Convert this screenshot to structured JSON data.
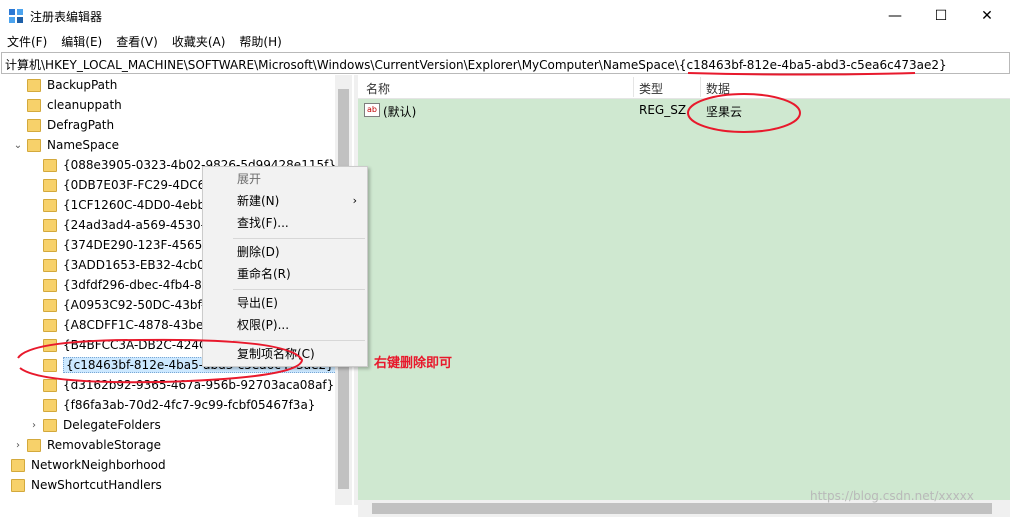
{
  "window": {
    "title": "注册表编辑器",
    "min_glyph": "—",
    "max_glyph": "☐",
    "close_glyph": "✕",
    "icon": "regedit-icon"
  },
  "menu": [
    "文件(F)",
    "编辑(E)",
    "查看(V)",
    "收藏夹(A)",
    "帮助(H)"
  ],
  "address": "计算机\\HKEY_LOCAL_MACHINE\\SOFTWARE\\Microsoft\\Windows\\CurrentVersion\\Explorer\\MyComputer\\NameSpace\\{c18463bf-812e-4ba5-abd3-c5ea6c473ae2}",
  "tree": [
    {
      "label": "BackupPath",
      "level": 1,
      "expander": ""
    },
    {
      "label": "cleanuppath",
      "level": 1,
      "expander": ""
    },
    {
      "label": "DefragPath",
      "level": 1,
      "expander": ""
    },
    {
      "label": "NameSpace",
      "level": 1,
      "expander": "⌄"
    },
    {
      "label": "{088e3905-0323-4b02-9826-5d99428e115f}",
      "level": 2,
      "expander": ""
    },
    {
      "label": "{0DB7E03F-FC29-4DC6-9",
      "level": 2,
      "expander": ""
    },
    {
      "label": "{1CF1260C-4DD0-4ebb-8",
      "level": 2,
      "expander": ""
    },
    {
      "label": "{24ad3ad4-a569-4530-9",
      "level": 2,
      "expander": ""
    },
    {
      "label": "{374DE290-123F-4565-9",
      "level": 2,
      "expander": ""
    },
    {
      "label": "{3ADD1653-EB32-4cb0-E",
      "level": 2,
      "expander": ""
    },
    {
      "label": "{3dfdf296-dbec-4fb4-81",
      "level": 2,
      "expander": ""
    },
    {
      "label": "{A0953C92-50DC-43bf-B",
      "level": 2,
      "expander": ""
    },
    {
      "label": "{A8CDFF1C-4878-43be-E",
      "level": 2,
      "expander": ""
    },
    {
      "label": "{B4BFCC3A-DB2C-424C-",
      "level": 2,
      "expander": ""
    },
    {
      "label": "{c18463bf-812e-4ba5-abd3-c5ea6c473ae2}",
      "level": 2,
      "expander": "",
      "selected": true
    },
    {
      "label": "{d3162b92-9365-467a-956b-92703aca08af}",
      "level": 2,
      "expander": ""
    },
    {
      "label": "{f86fa3ab-70d2-4fc7-9c99-fcbf05467f3a}",
      "level": 2,
      "expander": ""
    },
    {
      "label": "DelegateFolders",
      "level": 2,
      "expander": "›"
    },
    {
      "label": "RemovableStorage",
      "level": 1,
      "expander": "›"
    },
    {
      "label": "NetworkNeighborhood",
      "level": 0,
      "expander": ""
    },
    {
      "label": "NewShortcutHandlers",
      "level": 0,
      "expander": ""
    }
  ],
  "list": {
    "headers": [
      "名称",
      "类型",
      "数据"
    ],
    "rows": [
      {
        "name": "(默认)",
        "type": "REG_SZ",
        "data": "坚果云",
        "icon_text": "ab"
      }
    ]
  },
  "context_menu": {
    "items": [
      {
        "label": "展开",
        "disabled": true
      },
      {
        "label": "新建(N)",
        "submenu": true
      },
      {
        "label": "查找(F)..."
      },
      {
        "separator": true
      },
      {
        "label": "删除(D)"
      },
      {
        "label": "重命名(R)"
      },
      {
        "separator": true
      },
      {
        "label": "导出(E)"
      },
      {
        "label": "权限(P)..."
      },
      {
        "separator": true
      },
      {
        "label": "复制项名称(C)"
      }
    ],
    "submenu_glyph": "›"
  },
  "annotation": {
    "text": "右键删除即可",
    "color": "#e8192c"
  },
  "watermark": "https://blog.csdn.net/xxxxx",
  "colors": {
    "list_background": "#cfe8d0",
    "annotation_red": "#e8192c",
    "selection": "#cce8ff"
  }
}
